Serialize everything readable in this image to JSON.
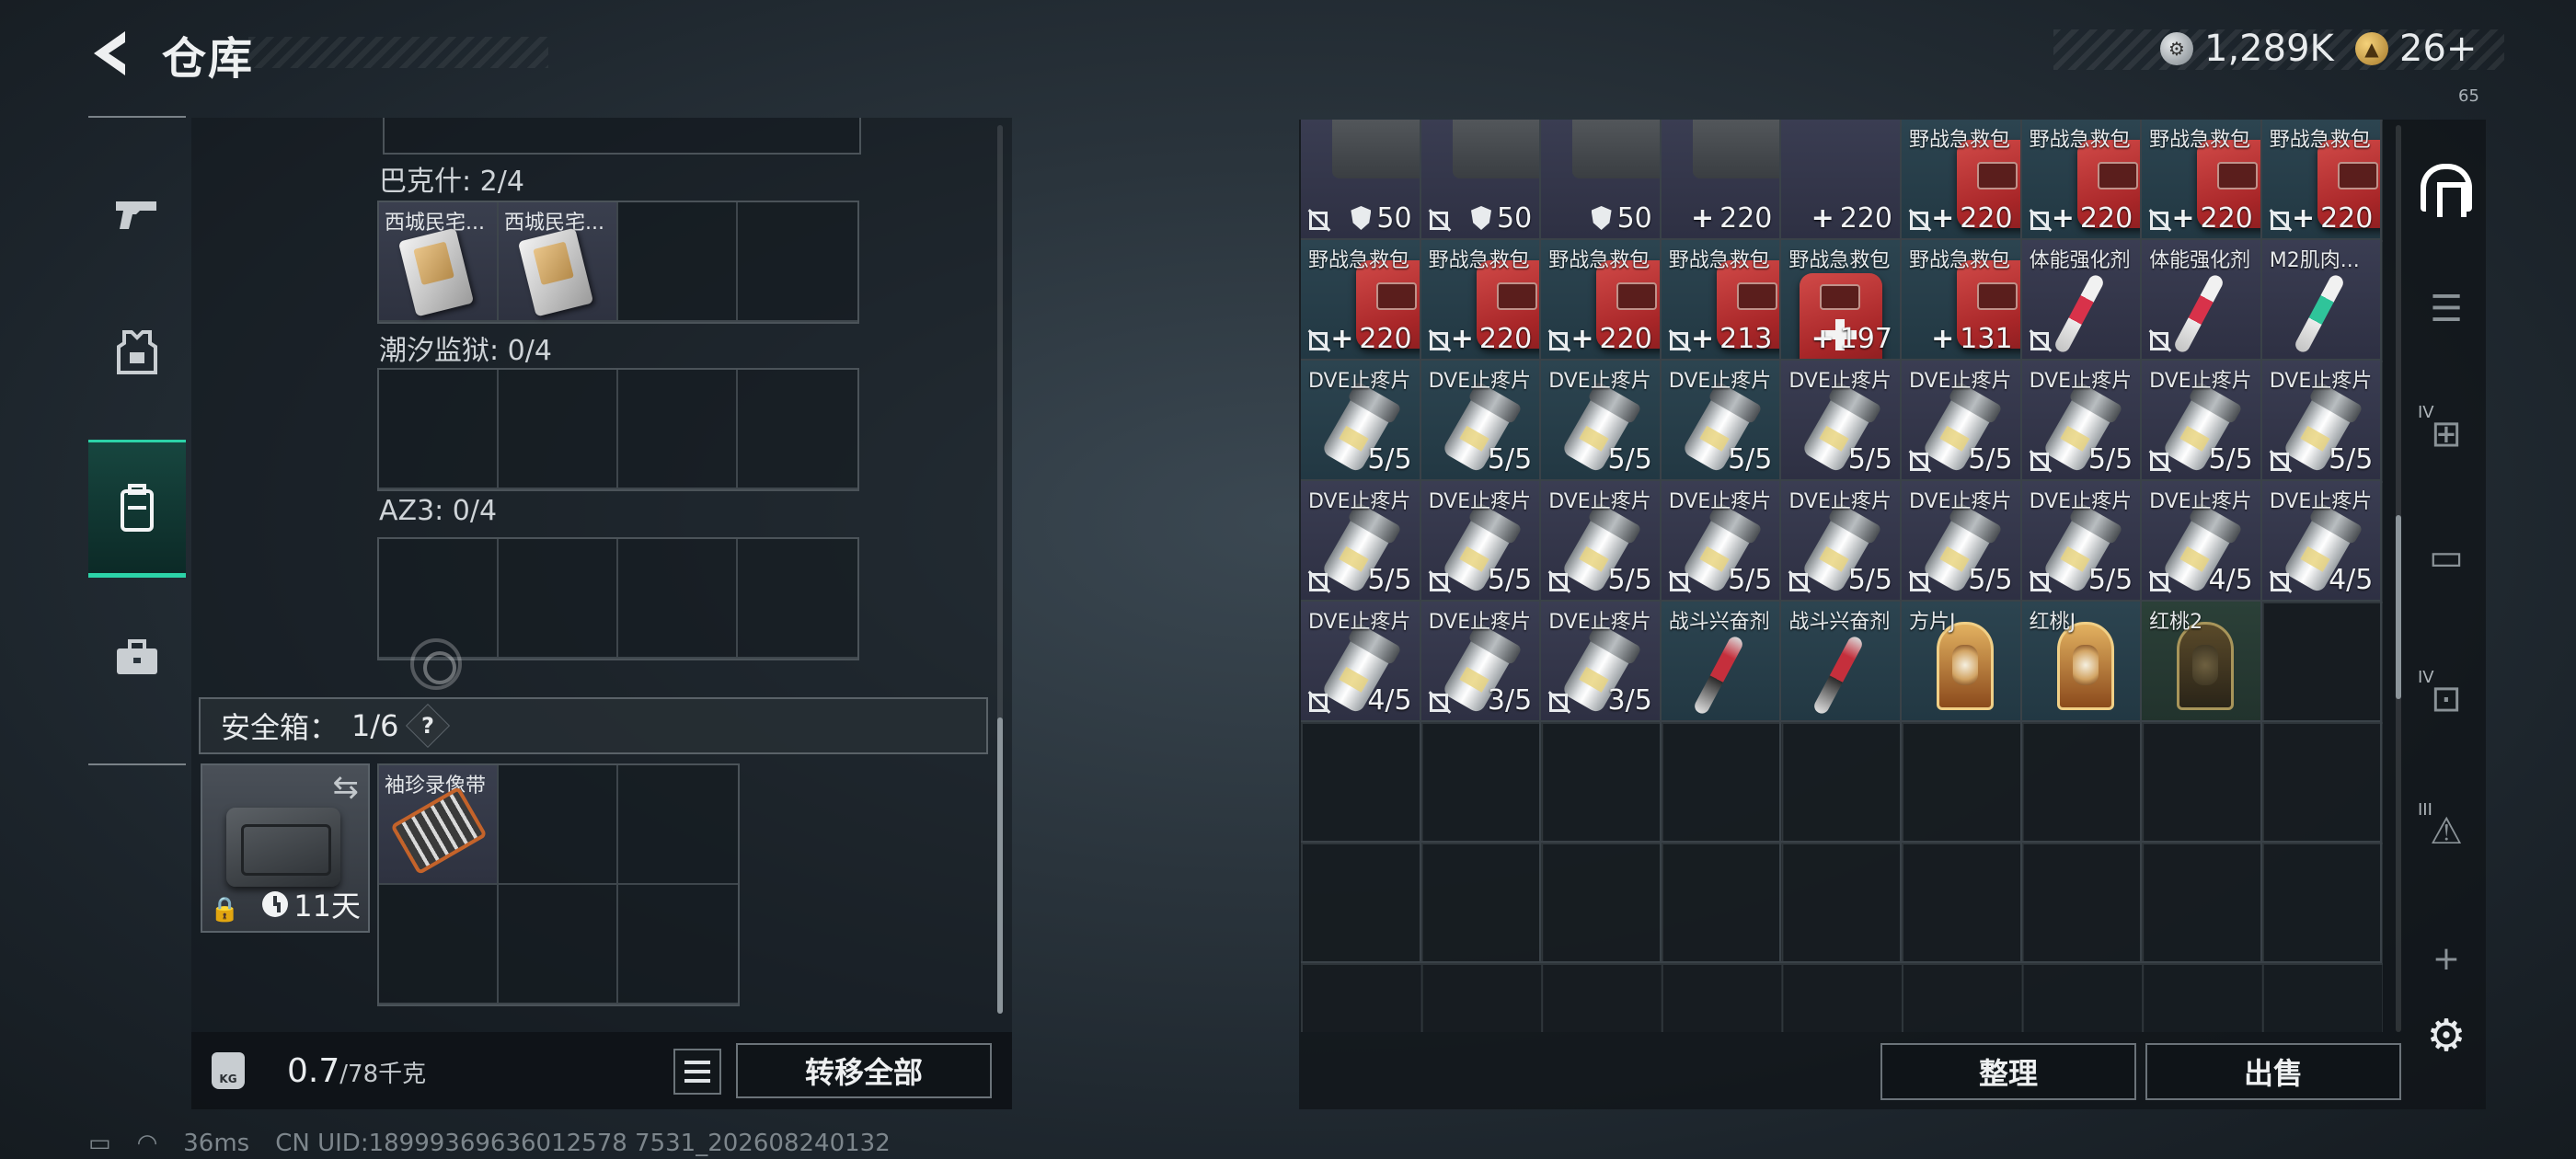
{
  "header": {
    "title": "仓库",
    "back_icon": "chevron-left-icon"
  },
  "currency": {
    "silver": "1,289K",
    "gold": "26+",
    "small": "65"
  },
  "nav": [
    {
      "icon": "pistol-icon",
      "symbol": "⌐"
    },
    {
      "icon": "armor-vest-icon",
      "symbol": "⛨"
    },
    {
      "icon": "backpack-icon",
      "symbol": "▤"
    },
    {
      "icon": "briefcase-icon",
      "symbol": "💼"
    }
  ],
  "backpack": {
    "sections": [
      {
        "label": "巴克什: 2/4",
        "items": [
          "西城民宅...",
          "西城民宅..."
        ]
      },
      {
        "label": "潮汐监狱: 0/4",
        "items": []
      },
      {
        "label": "AZ3: 0/4",
        "items": []
      }
    ],
    "safe_box": {
      "label": "安全箱：",
      "count": "1/6",
      "help": "?",
      "days": "11天",
      "item": "袖珍录像带"
    },
    "weight": {
      "value": "0.7",
      "max": "/78千克",
      "kg_icon": "KG"
    },
    "transfer_all": "转移全部"
  },
  "stash": {
    "items": [
      {
        "name": "",
        "count": "50",
        "type": "crate",
        "shield": true,
        "nt": true,
        "bg": "purple"
      },
      {
        "name": "",
        "count": "50",
        "type": "crate",
        "shield": true,
        "nt": true,
        "bg": "purple"
      },
      {
        "name": "",
        "count": "50",
        "type": "crate",
        "shield": true,
        "nt": false,
        "bg": "purple"
      },
      {
        "name": "",
        "count": "220",
        "type": "crate",
        "plus": true,
        "nt": false,
        "bg": "purple"
      },
      {
        "name": "",
        "count": "220",
        "type": "blank",
        "plus": true,
        "nt": false,
        "bg": "purple"
      },
      {
        "name": "野战急救包",
        "count": "220",
        "type": "medkit",
        "plus": true,
        "nt": true,
        "bg": "blue"
      },
      {
        "name": "野战急救包",
        "count": "220",
        "type": "medkit",
        "plus": true,
        "nt": true,
        "bg": "blue"
      },
      {
        "name": "野战急救包",
        "count": "220",
        "type": "medkit",
        "plus": true,
        "nt": true,
        "bg": "blue"
      },
      {
        "name": "野战急救包",
        "count": "220",
        "type": "medkit",
        "plus": true,
        "nt": true,
        "bg": "blue"
      },
      {
        "name": "野战急救包",
        "count": "220",
        "type": "medkit",
        "plus": true,
        "nt": true,
        "bg": "blue"
      },
      {
        "name": "野战急救包",
        "count": "220",
        "type": "medkit",
        "plus": true,
        "nt": true,
        "bg": "blue"
      },
      {
        "name": "野战急救包",
        "count": "220",
        "type": "medkit",
        "plus": true,
        "nt": true,
        "bg": "blue"
      },
      {
        "name": "野战急救包",
        "count": "213",
        "type": "medkit",
        "plus": true,
        "nt": true,
        "bg": "blue"
      },
      {
        "name": "野战急救包",
        "count": "197",
        "type": "medkit-small",
        "plus": true,
        "nt": false,
        "bg": "blue"
      },
      {
        "name": "野战急救包",
        "count": "131",
        "type": "medkit",
        "plus": true,
        "nt": false,
        "bg": "blue"
      },
      {
        "name": "体能强化剂",
        "count": "",
        "type": "syringe",
        "nt": true,
        "bg": "purple"
      },
      {
        "name": "体能强化剂",
        "count": "",
        "type": "syringe",
        "nt": true,
        "bg": "purple"
      },
      {
        "name": "M2肌肉...",
        "count": "",
        "type": "syringe-green",
        "nt": false,
        "bg": "purple"
      },
      {
        "name": "DVE止疼片",
        "count": "5/5",
        "type": "pill",
        "nt": false,
        "bg": "blue"
      },
      {
        "name": "DVE止疼片",
        "count": "5/5",
        "type": "pill",
        "nt": false,
        "bg": "blue"
      },
      {
        "name": "DVE止疼片",
        "count": "5/5",
        "type": "pill",
        "nt": false,
        "bg": "blue"
      },
      {
        "name": "DVE止疼片",
        "count": "5/5",
        "type": "pill",
        "nt": false,
        "bg": "blue"
      },
      {
        "name": "DVE止疼片",
        "count": "5/5",
        "type": "pill",
        "nt": false,
        "bg": "purple"
      },
      {
        "name": "DVE止疼片",
        "count": "5/5",
        "type": "pill",
        "nt": true,
        "bg": "purple"
      },
      {
        "name": "DVE止疼片",
        "count": "5/5",
        "type": "pill",
        "nt": true,
        "bg": "purple"
      },
      {
        "name": "DVE止疼片",
        "count": "5/5",
        "type": "pill",
        "nt": true,
        "bg": "purple"
      },
      {
        "name": "DVE止疼片",
        "count": "5/5",
        "type": "pill",
        "nt": true,
        "bg": "purple"
      },
      {
        "name": "DVE止疼片",
        "count": "5/5",
        "type": "pill",
        "nt": true,
        "bg": "purple"
      },
      {
        "name": "DVE止疼片",
        "count": "5/5",
        "type": "pill",
        "nt": true,
        "bg": "purple"
      },
      {
        "name": "DVE止疼片",
        "count": "5/5",
        "type": "pill",
        "nt": true,
        "bg": "purple"
      },
      {
        "name": "DVE止疼片",
        "count": "5/5",
        "type": "pill",
        "nt": true,
        "bg": "purple"
      },
      {
        "name": "DVE止疼片",
        "count": "5/5",
        "type": "pill",
        "nt": true,
        "bg": "purple"
      },
      {
        "name": "DVE止疼片",
        "count": "5/5",
        "type": "pill",
        "nt": true,
        "bg": "purple"
      },
      {
        "name": "DVE止疼片",
        "count": "5/5",
        "type": "pill",
        "nt": true,
        "bg": "purple"
      },
      {
        "name": "DVE止疼片",
        "count": "4/5",
        "type": "pill",
        "nt": true,
        "bg": "purple"
      },
      {
        "name": "DVE止疼片",
        "count": "4/5",
        "type": "pill",
        "nt": true,
        "bg": "purple"
      },
      {
        "name": "DVE止疼片",
        "count": "4/5",
        "type": "pill",
        "nt": true,
        "bg": "purple"
      },
      {
        "name": "DVE止疼片",
        "count": "3/5",
        "type": "pill",
        "nt": true,
        "bg": "purple"
      },
      {
        "name": "DVE止疼片",
        "count": "3/5",
        "type": "pill",
        "nt": true,
        "bg": "purple"
      },
      {
        "name": "战斗兴奋剂",
        "count": "",
        "type": "syringe-red",
        "nt": false,
        "bg": "blue"
      },
      {
        "name": "战斗兴奋剂",
        "count": "",
        "type": "syringe-red",
        "nt": false,
        "bg": "blue"
      },
      {
        "name": "方片J",
        "count": "",
        "type": "card",
        "nt": false,
        "bg": "blue"
      },
      {
        "name": "红桃J",
        "count": "",
        "type": "card",
        "nt": false,
        "bg": "blue"
      },
      {
        "name": "红桃2",
        "count": "",
        "type": "card-dark",
        "nt": false,
        "bg": "green"
      }
    ],
    "organize": "整理",
    "sell": "出售"
  },
  "rail": [
    {
      "icon": "home-base-icon",
      "tag": ""
    },
    {
      "icon": "document-stack-icon",
      "tag": ""
    },
    {
      "icon": "tier4-medical-icon",
      "tag": "IV"
    },
    {
      "icon": "folder-icon",
      "tag": ""
    },
    {
      "icon": "tier4-camera-icon",
      "tag": "IV"
    },
    {
      "icon": "tier3-warning-icon",
      "tag": "III"
    },
    {
      "icon": "plus-icon",
      "tag": ""
    },
    {
      "icon": "gear-icon",
      "tag": ""
    }
  ],
  "status": {
    "ping": "36ms",
    "uid": "CN UID:18999369636012578 7531_202608240132"
  }
}
